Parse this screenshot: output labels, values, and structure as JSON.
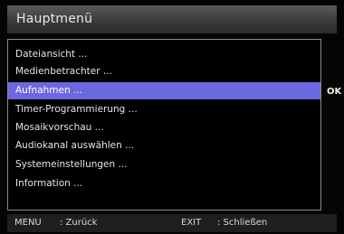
{
  "title": "Hauptmenü",
  "menu": {
    "items": [
      {
        "label": "Dateiansicht ..."
      },
      {
        "label": "Medienbetrachter ..."
      },
      {
        "label": "Aufnahmen ..."
      },
      {
        "label": "Timer-Programmierung ..."
      },
      {
        "label": "Mosaikvorschau ..."
      },
      {
        "label": "Audiokanal auswählen ..."
      },
      {
        "label": "Systemeinstellungen ..."
      },
      {
        "label": "Information ..."
      }
    ],
    "selected_index": 2,
    "selected_color": "#6b68e0"
  },
  "ok_label": "OK",
  "footer": {
    "menu_key": "MENU",
    "menu_action": ": Zurück",
    "exit_key": "EXIT",
    "exit_action": ": Schließen"
  }
}
